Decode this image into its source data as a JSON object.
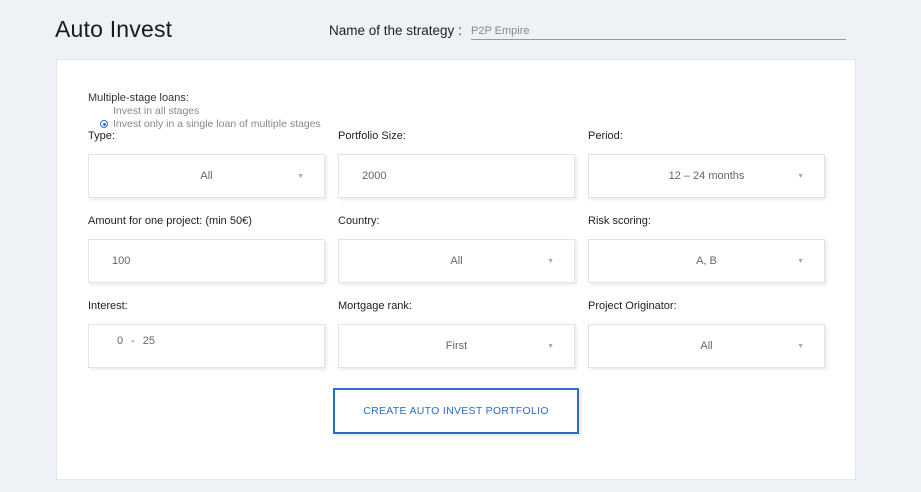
{
  "header": {
    "title": "Auto Invest",
    "strategy_label": "Name of the strategy :",
    "strategy_value": "P2P Empire"
  },
  "multiple_stage": {
    "label": "Multiple-stage loans:",
    "options": [
      {
        "label": "Invest in all stages",
        "selected": false
      },
      {
        "label": "Invest only in a single loan of multiple stages",
        "selected": true
      }
    ]
  },
  "fields": {
    "type": {
      "label": "Type:",
      "value": "All"
    },
    "portfolio_size": {
      "label": "Portfolio Size:",
      "value": "2000"
    },
    "period": {
      "label": "Period:",
      "value": "12 – 24 months"
    },
    "amount": {
      "label": "Amount for one project: (min 50€)",
      "value": "100"
    },
    "country": {
      "label": "Country:",
      "value": "All"
    },
    "risk_scoring": {
      "label": "Risk scoring:",
      "value": "A, B"
    },
    "interest": {
      "label": "Interest:",
      "min": "0",
      "separator": "-",
      "max": "25"
    },
    "mortgage_rank": {
      "label": "Mortgage rank:",
      "value": "First"
    },
    "project_originator": {
      "label": "Project Originator:",
      "value": "All"
    }
  },
  "icons": {
    "dropdown": "caret-down-icon"
  },
  "actions": {
    "create_label": "CREATE AUTO INVEST PORTFOLIO"
  },
  "colors": {
    "accent": "#2b6cc9",
    "background": "#eef1f6"
  }
}
